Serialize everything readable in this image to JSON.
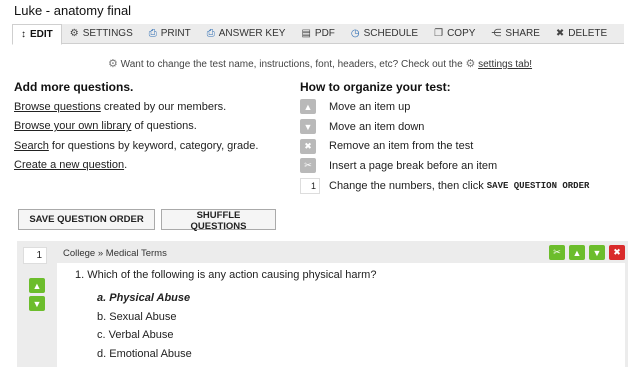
{
  "title": "Luke - anatomy final",
  "tabs": [
    {
      "label": "EDIT",
      "icon": "move-vertical-icon",
      "glyph": "↕"
    },
    {
      "label": "SETTINGS",
      "icon": "gear-icon",
      "glyph": "⚙"
    },
    {
      "label": "PRINT",
      "icon": "printer-icon",
      "glyph": "⎙"
    },
    {
      "label": "ANSWER KEY",
      "icon": "printer-icon",
      "glyph": "⎙"
    },
    {
      "label": "PDF",
      "icon": "document-icon",
      "glyph": "▤"
    },
    {
      "label": "SCHEDULE",
      "icon": "clock-icon",
      "glyph": "◷"
    },
    {
      "label": "COPY",
      "icon": "copy-icon",
      "glyph": "❐"
    },
    {
      "label": "SHARE",
      "icon": "share-icon",
      "glyph": "⋲"
    },
    {
      "label": "DELETE",
      "icon": "close-icon",
      "glyph": "✖"
    }
  ],
  "notice": {
    "text": "Want to change the test name, instructions, font, headers, etc? Check out the",
    "link": "settings tab!"
  },
  "add_more": {
    "heading": "Add more questions.",
    "lines": [
      {
        "link": "Browse questions",
        "rest": " created by our members."
      },
      {
        "link": "Browse your own library",
        "rest": " of questions."
      },
      {
        "link": "Search",
        "rest": " for questions by keyword, category, grade."
      },
      {
        "link": "Create a new question",
        "rest": "."
      }
    ]
  },
  "organize": {
    "heading": "How to organize your test:",
    "items": [
      {
        "icon": "chevron-up-icon",
        "glyph": "▲",
        "text": "Move an item up"
      },
      {
        "icon": "chevron-down-icon",
        "glyph": "▼",
        "text": "Move an item down"
      },
      {
        "icon": "close-icon",
        "glyph": "✖",
        "text": "Remove an item from the test"
      },
      {
        "icon": "page-break-icon",
        "glyph": "✂",
        "text": "Insert a page break before an item"
      }
    ],
    "renumber": {
      "number": "1",
      "text": "Change the numbers, then click",
      "code": "SAVE QUESTION ORDER"
    }
  },
  "buttons": {
    "save_order": "SAVE QUESTION ORDER",
    "shuffle": "SHUFFLE QUESTIONS"
  },
  "question": {
    "order_number": "1",
    "breadcrumb": "College » Medical Terms",
    "text": "1.  Which of the following is any action causing physical harm?",
    "choices": [
      {
        "label": "a. Physical Abuse",
        "correct": true
      },
      {
        "label": "b. Sexual Abuse",
        "correct": false
      },
      {
        "label": "c. Verbal Abuse",
        "correct": false
      },
      {
        "label": "d. Emotional Abuse",
        "correct": false
      }
    ]
  },
  "colors": {
    "accent_green": "#6cbd2c",
    "accent_red": "#d92b2b",
    "link_blue": "#2d6db4"
  }
}
